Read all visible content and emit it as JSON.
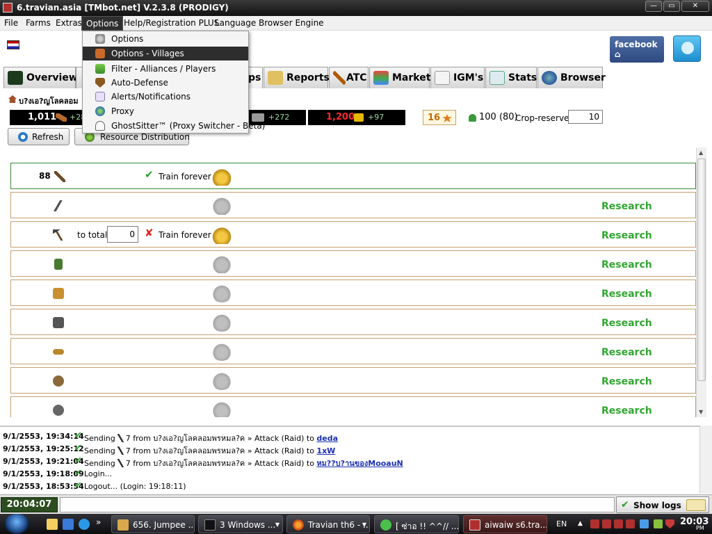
{
  "window": {
    "title": "6.travian.asia [TMbot.net] V.2.3.8 (PRODIGY)",
    "controls": {
      "minimize": "—",
      "maximize": "▭",
      "close": "✕"
    }
  },
  "menubar": {
    "items": [
      "File",
      "Farms",
      "Extras",
      "Options",
      "Help/Registration PLUS",
      "Language",
      "Browser Engine"
    ],
    "active": "Options"
  },
  "options_menu": {
    "items": [
      {
        "label": "Options",
        "icon": "options-gear-icon",
        "highlighted": false
      },
      {
        "label": "Options - Villages",
        "icon": "villages-icon",
        "highlighted": true
      },
      {
        "label": "Filter - Alliances / Players",
        "icon": "filter-icon",
        "highlighted": false
      },
      {
        "label": "Auto-Defense",
        "icon": "shield-icon",
        "highlighted": false
      },
      {
        "label": "Alerts/Notifications",
        "icon": "alert-icon",
        "highlighted": false
      },
      {
        "label": "Proxy",
        "icon": "globe-icon",
        "highlighted": false
      },
      {
        "label": "GhostSitter™ (Proxy Switcher - Beta)",
        "icon": "ghost-icon",
        "highlighted": false
      }
    ]
  },
  "social": {
    "facebook_label": "facebook"
  },
  "tabs": [
    {
      "label": "Overview",
      "icon": "overview-icon"
    },
    {
      "label": "ps",
      "icon": "troops-icon"
    },
    {
      "label": "Reports",
      "icon": "reports-icon"
    },
    {
      "label": "ATC",
      "icon": "atc-icon"
    },
    {
      "label": "Market",
      "icon": "market-icon"
    },
    {
      "label": "IGM's",
      "icon": "igm-icon"
    },
    {
      "label": "Stats",
      "icon": "stats-icon"
    },
    {
      "label": "Browser",
      "icon": "browser-icon"
    }
  ],
  "village": {
    "name": "บ?งเอ?ญโลคลอม"
  },
  "resources": {
    "wood": {
      "value": "1,011",
      "rate": "+28"
    },
    "iron": {
      "rate": "+272"
    },
    "crop": {
      "value": "1,200",
      "rate": "+97"
    },
    "attacks": "16",
    "population": "100 (80)",
    "crop_reserves_label": "Crop-reserves:",
    "crop_reserves_value": "10"
  },
  "buttons": {
    "refresh": "Refresh",
    "resource_distribution": "Resource Distribution"
  },
  "troops": {
    "train_forever_label": "Train forever",
    "to_total_label": "to total",
    "research_label": "Research",
    "rows": [
      {
        "count": "88",
        "unit": "clubswinger",
        "mode": "train-check"
      },
      {
        "count": "",
        "unit": "spearman",
        "mode": "research"
      },
      {
        "count": "",
        "unit": "axeman",
        "mode": "train-x",
        "total": "0"
      },
      {
        "count": "",
        "unit": "scout",
        "mode": "research"
      },
      {
        "count": "",
        "unit": "paladin",
        "mode": "research"
      },
      {
        "count": "",
        "unit": "teutonic-knight",
        "mode": "research"
      },
      {
        "count": "",
        "unit": "ram",
        "mode": "research"
      },
      {
        "count": "",
        "unit": "catapult",
        "mode": "research"
      },
      {
        "count": "",
        "unit": "chief",
        "mode": "research"
      }
    ]
  },
  "logs": [
    {
      "date": "9/1/2553, 19:34:14",
      "text_prefix": "Sending",
      "text_mid": "7  from บ?งเอ?ญโลคลอมพรหมล?ค » Attack (Raid) to",
      "link": "deda"
    },
    {
      "date": "9/1/2553, 19:25:12",
      "text_prefix": "Sending",
      "text_mid": "7  from บ?งเอ?ญโลคลอมพรหมล?ค » Attack (Raid) to",
      "link": "1xW"
    },
    {
      "date": "9/1/2553, 19:21:04",
      "text_prefix": "Sending",
      "text_mid": "7  from บ?งเอ?ญโลคลอมพรหมล?ค » Attack (Raid) to",
      "link": "หม??บ?านของMooauN"
    },
    {
      "date": "9/1/2553, 19:18:09",
      "text_prefix": "Login...",
      "text_mid": "",
      "link": ""
    },
    {
      "date": "9/1/2553, 18:53:54",
      "text_prefix": "Logout... (Login: 19:18:11)",
      "text_mid": "",
      "link": ""
    }
  ],
  "statusbar": {
    "clock": "20:04:07",
    "show_logs_label": "Show logs"
  },
  "taskbar": {
    "tasks": [
      {
        "label": "656. Jumpee ...",
        "active": false,
        "dropdown": false
      },
      {
        "label": "3 Windows ...",
        "active": false,
        "dropdown": true
      },
      {
        "label": "Travian th6 - ...",
        "active": false,
        "dropdown": true
      },
      {
        "label": "[ ซ่าอ !! ^^// ...",
        "active": false,
        "dropdown": false
      },
      {
        "label": "aiwaiw s6.tra...",
        "active": true,
        "dropdown": false
      }
    ],
    "language": "EN",
    "clock": "20:03",
    "ampm": "PM",
    "quicklaunch_more": "»"
  },
  "colors": {
    "research_green": "#31a531",
    "accent_dark": "#2d2d2d",
    "link_blue": "#1a2fb0",
    "clock_bg": "#2c4d1f"
  }
}
